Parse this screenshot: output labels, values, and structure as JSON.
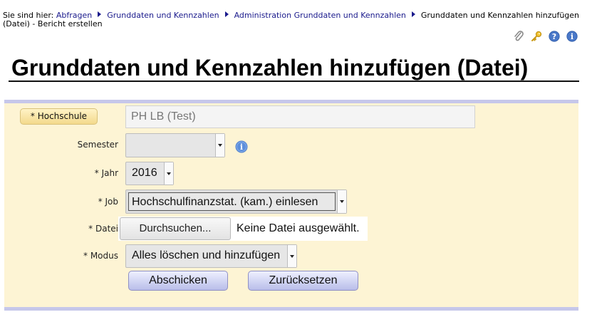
{
  "breadcrumb": {
    "prefix": "Sie sind hier:",
    "items": [
      "Abfragen",
      "Grunddaten und Kennzahlen",
      "Administration Grunddaten und Kennzahlen"
    ],
    "current": "Grunddaten und Kennzahlen hinzufügen (Datei) - Bericht erstellen"
  },
  "toolbar": {
    "icons": [
      "paperclip-icon",
      "key-icon",
      "help-icon",
      "info-icon"
    ]
  },
  "page": {
    "title": "Grunddaten und Kennzahlen hinzufügen (Datei)"
  },
  "form": {
    "hochschule": {
      "label": "* Hochschule",
      "value": "PH LB (Test)"
    },
    "semester": {
      "label": "Semester",
      "value": ""
    },
    "jahr": {
      "label": "* Jahr",
      "value": "2016"
    },
    "job": {
      "label": "* Job",
      "value": "Hochschulfinanzstat. (kam.) einlesen"
    },
    "datei": {
      "label": "* Datei",
      "button": "Durchsuchen...",
      "status": "Keine Datei ausgewählt."
    },
    "modus": {
      "label": "* Modus",
      "value": "Alles löschen und hinzufügen"
    },
    "submit_label": "Abschicken",
    "reset_label": "Zurücksetzen"
  },
  "colors": {
    "form_background": "#fdf4d4",
    "form_border": "#c6c7ea",
    "link": "#1a1a8c"
  }
}
